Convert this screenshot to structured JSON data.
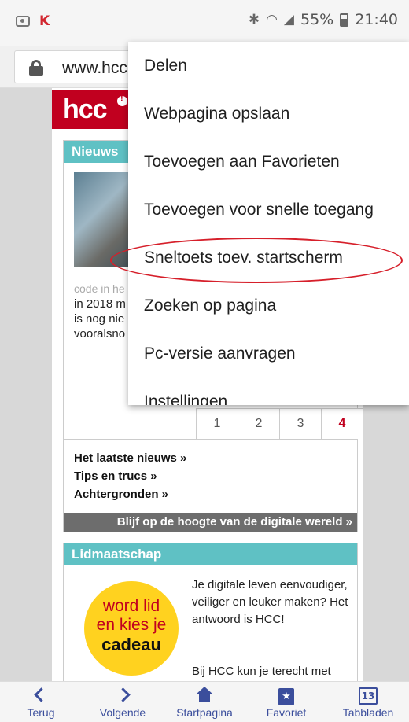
{
  "status_bar": {
    "battery": "55%",
    "time": "21:40",
    "icons": [
      "image-icon",
      "kaspersky-icon",
      "bluetooth-icon",
      "wifi-icon",
      "signal-icon",
      "battery-icon"
    ]
  },
  "url_bar": {
    "url": "www.hcc"
  },
  "page": {
    "logo_text": "hcc",
    "news": {
      "header": "Nieuws",
      "caption": "code in he",
      "text": "in 2018 m is nog nie vooralsno",
      "pages": [
        "1",
        "2",
        "3",
        "4"
      ],
      "active_page": "4",
      "links": [
        "Het laatste nieuws »",
        "Tips en trucs »",
        "Achtergronden »"
      ],
      "banner": "Blijf op de hoogte van de digitale wereld »"
    },
    "membership": {
      "header": "Lidmaatschap",
      "badge_line1": "word lid",
      "badge_line2": "en kies je",
      "badge_line3": "cadeau",
      "text": "Je digitale leven eenvoudiger, veiliger en leuker maken? Het antwoord is HCC!",
      "text2": "Bij HCC kun je terecht met"
    }
  },
  "menu": {
    "items": [
      "Delen",
      "Webpagina opslaan",
      "Toevoegen aan Favorieten",
      "Toevoegen voor snelle toegang",
      "Sneltoets toev. startscherm",
      "Zoeken op pagina",
      "Pc-versie aanvragen",
      "Instellingen"
    ],
    "highlight_color": "#d61f2a"
  },
  "bottom_bar": {
    "back": "Terug",
    "forward": "Volgende",
    "home": "Startpagina",
    "favorite": "Favoriet",
    "tabs": "Tabbladen",
    "tab_count": "13"
  }
}
